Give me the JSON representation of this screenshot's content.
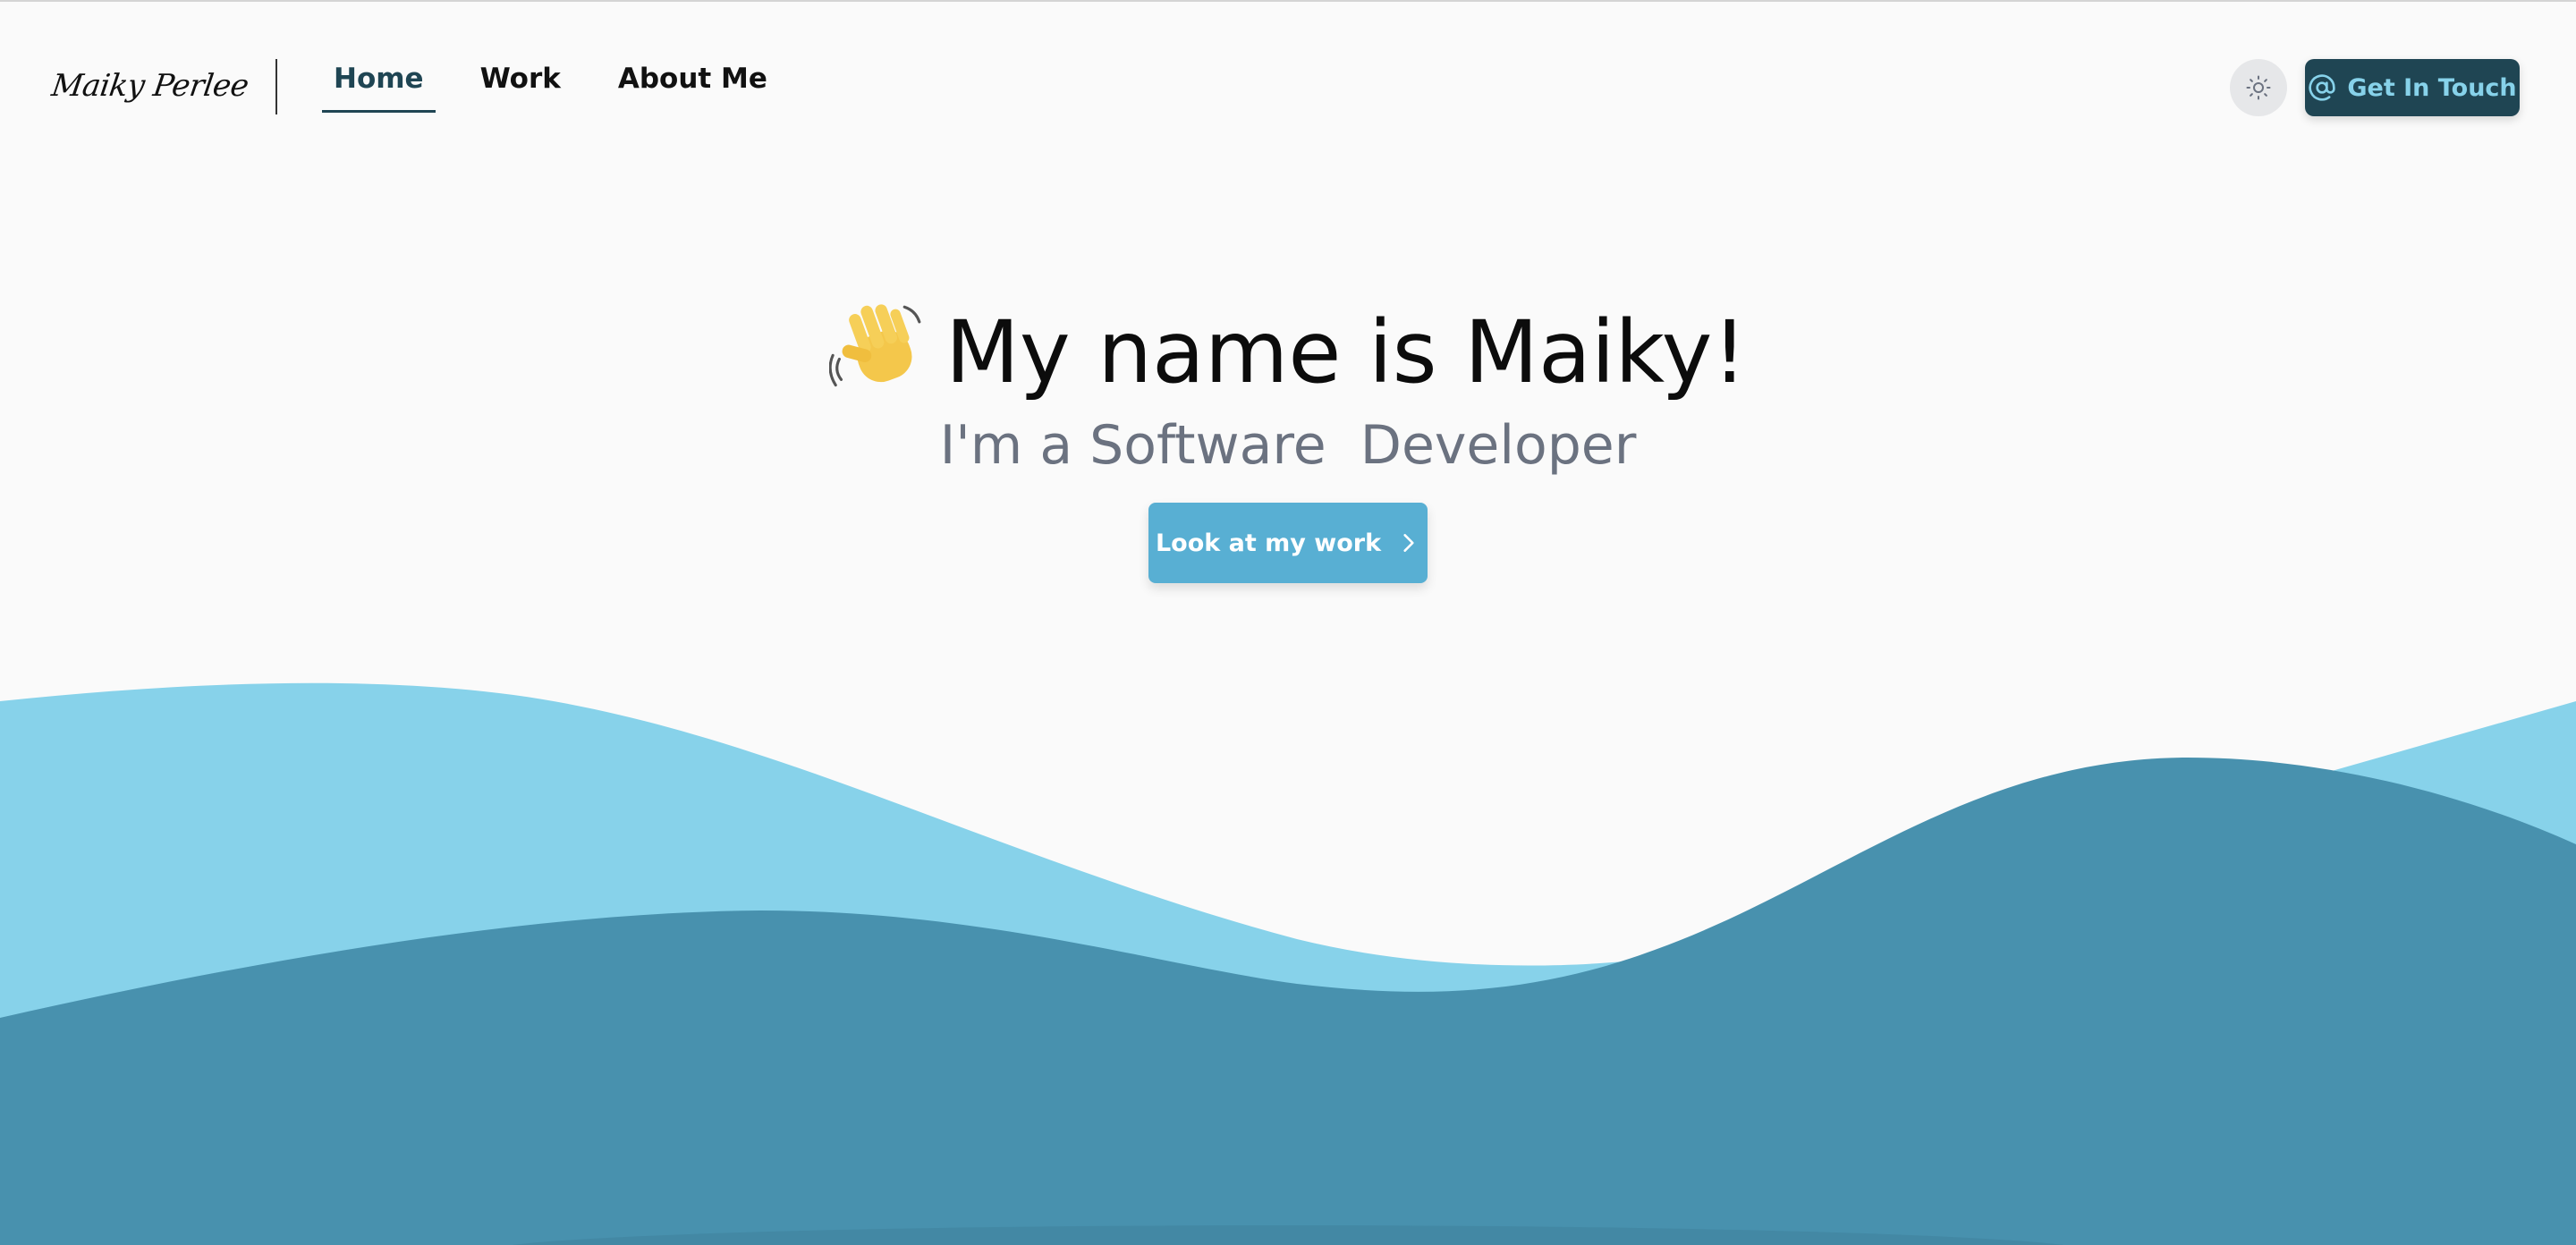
{
  "header": {
    "logo_text": "Maiky Perlee",
    "nav": [
      {
        "label": "Home",
        "active": true
      },
      {
        "label": "Work",
        "active": false
      },
      {
        "label": "About Me",
        "active": false
      }
    ],
    "theme_toggle_icon": "sun-icon",
    "contact_button": {
      "label": "Get In Touch",
      "icon": "at-sign-icon"
    }
  },
  "hero": {
    "emoji_icon": "waving-hand-icon",
    "title": "My name is Maiky!",
    "subtitle": "I'm a Software  Developer",
    "cta": {
      "label": "Look at my work",
      "icon": "chevron-right-icon"
    }
  },
  "colors": {
    "background": "#fafafa",
    "wave_light": "#87d2ea",
    "wave_dark": "#4891ae",
    "contact_bg": "#1f4553",
    "contact_text": "#87d2ea",
    "cta_bg": "#58afd3",
    "subtitle": "#6b7280"
  }
}
